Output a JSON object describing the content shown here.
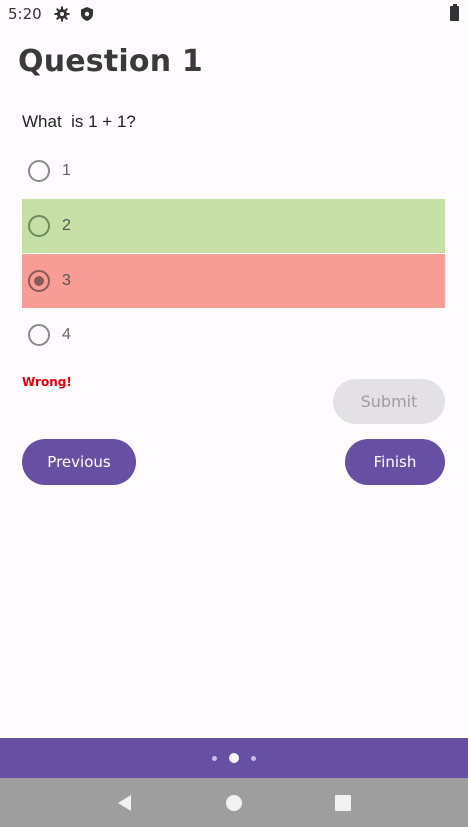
{
  "status_bar": {
    "time": "5:20",
    "icons": [
      "gear-icon",
      "shield-icon",
      "battery-icon"
    ]
  },
  "quiz": {
    "title": "Question 1",
    "question": "What  is 1 + 1?",
    "options": [
      {
        "label": "1",
        "state": "default",
        "selected": false
      },
      {
        "label": "2",
        "state": "correct",
        "selected": false
      },
      {
        "label": "3",
        "state": "wrong",
        "selected": true
      },
      {
        "label": "4",
        "state": "default",
        "selected": false
      }
    ],
    "feedback": "Wrong!",
    "submit_label": "Submit",
    "previous_label": "Previous",
    "finish_label": "Finish"
  },
  "pager": {
    "count": 3,
    "active_index": 1
  },
  "colors": {
    "accent": "#6750a4",
    "correct": "#c5dfa6",
    "wrong": "#f89d95",
    "feedback": "#e8000b"
  },
  "nav_bar": {
    "icons": [
      "back-icon",
      "home-icon",
      "recents-icon"
    ]
  }
}
